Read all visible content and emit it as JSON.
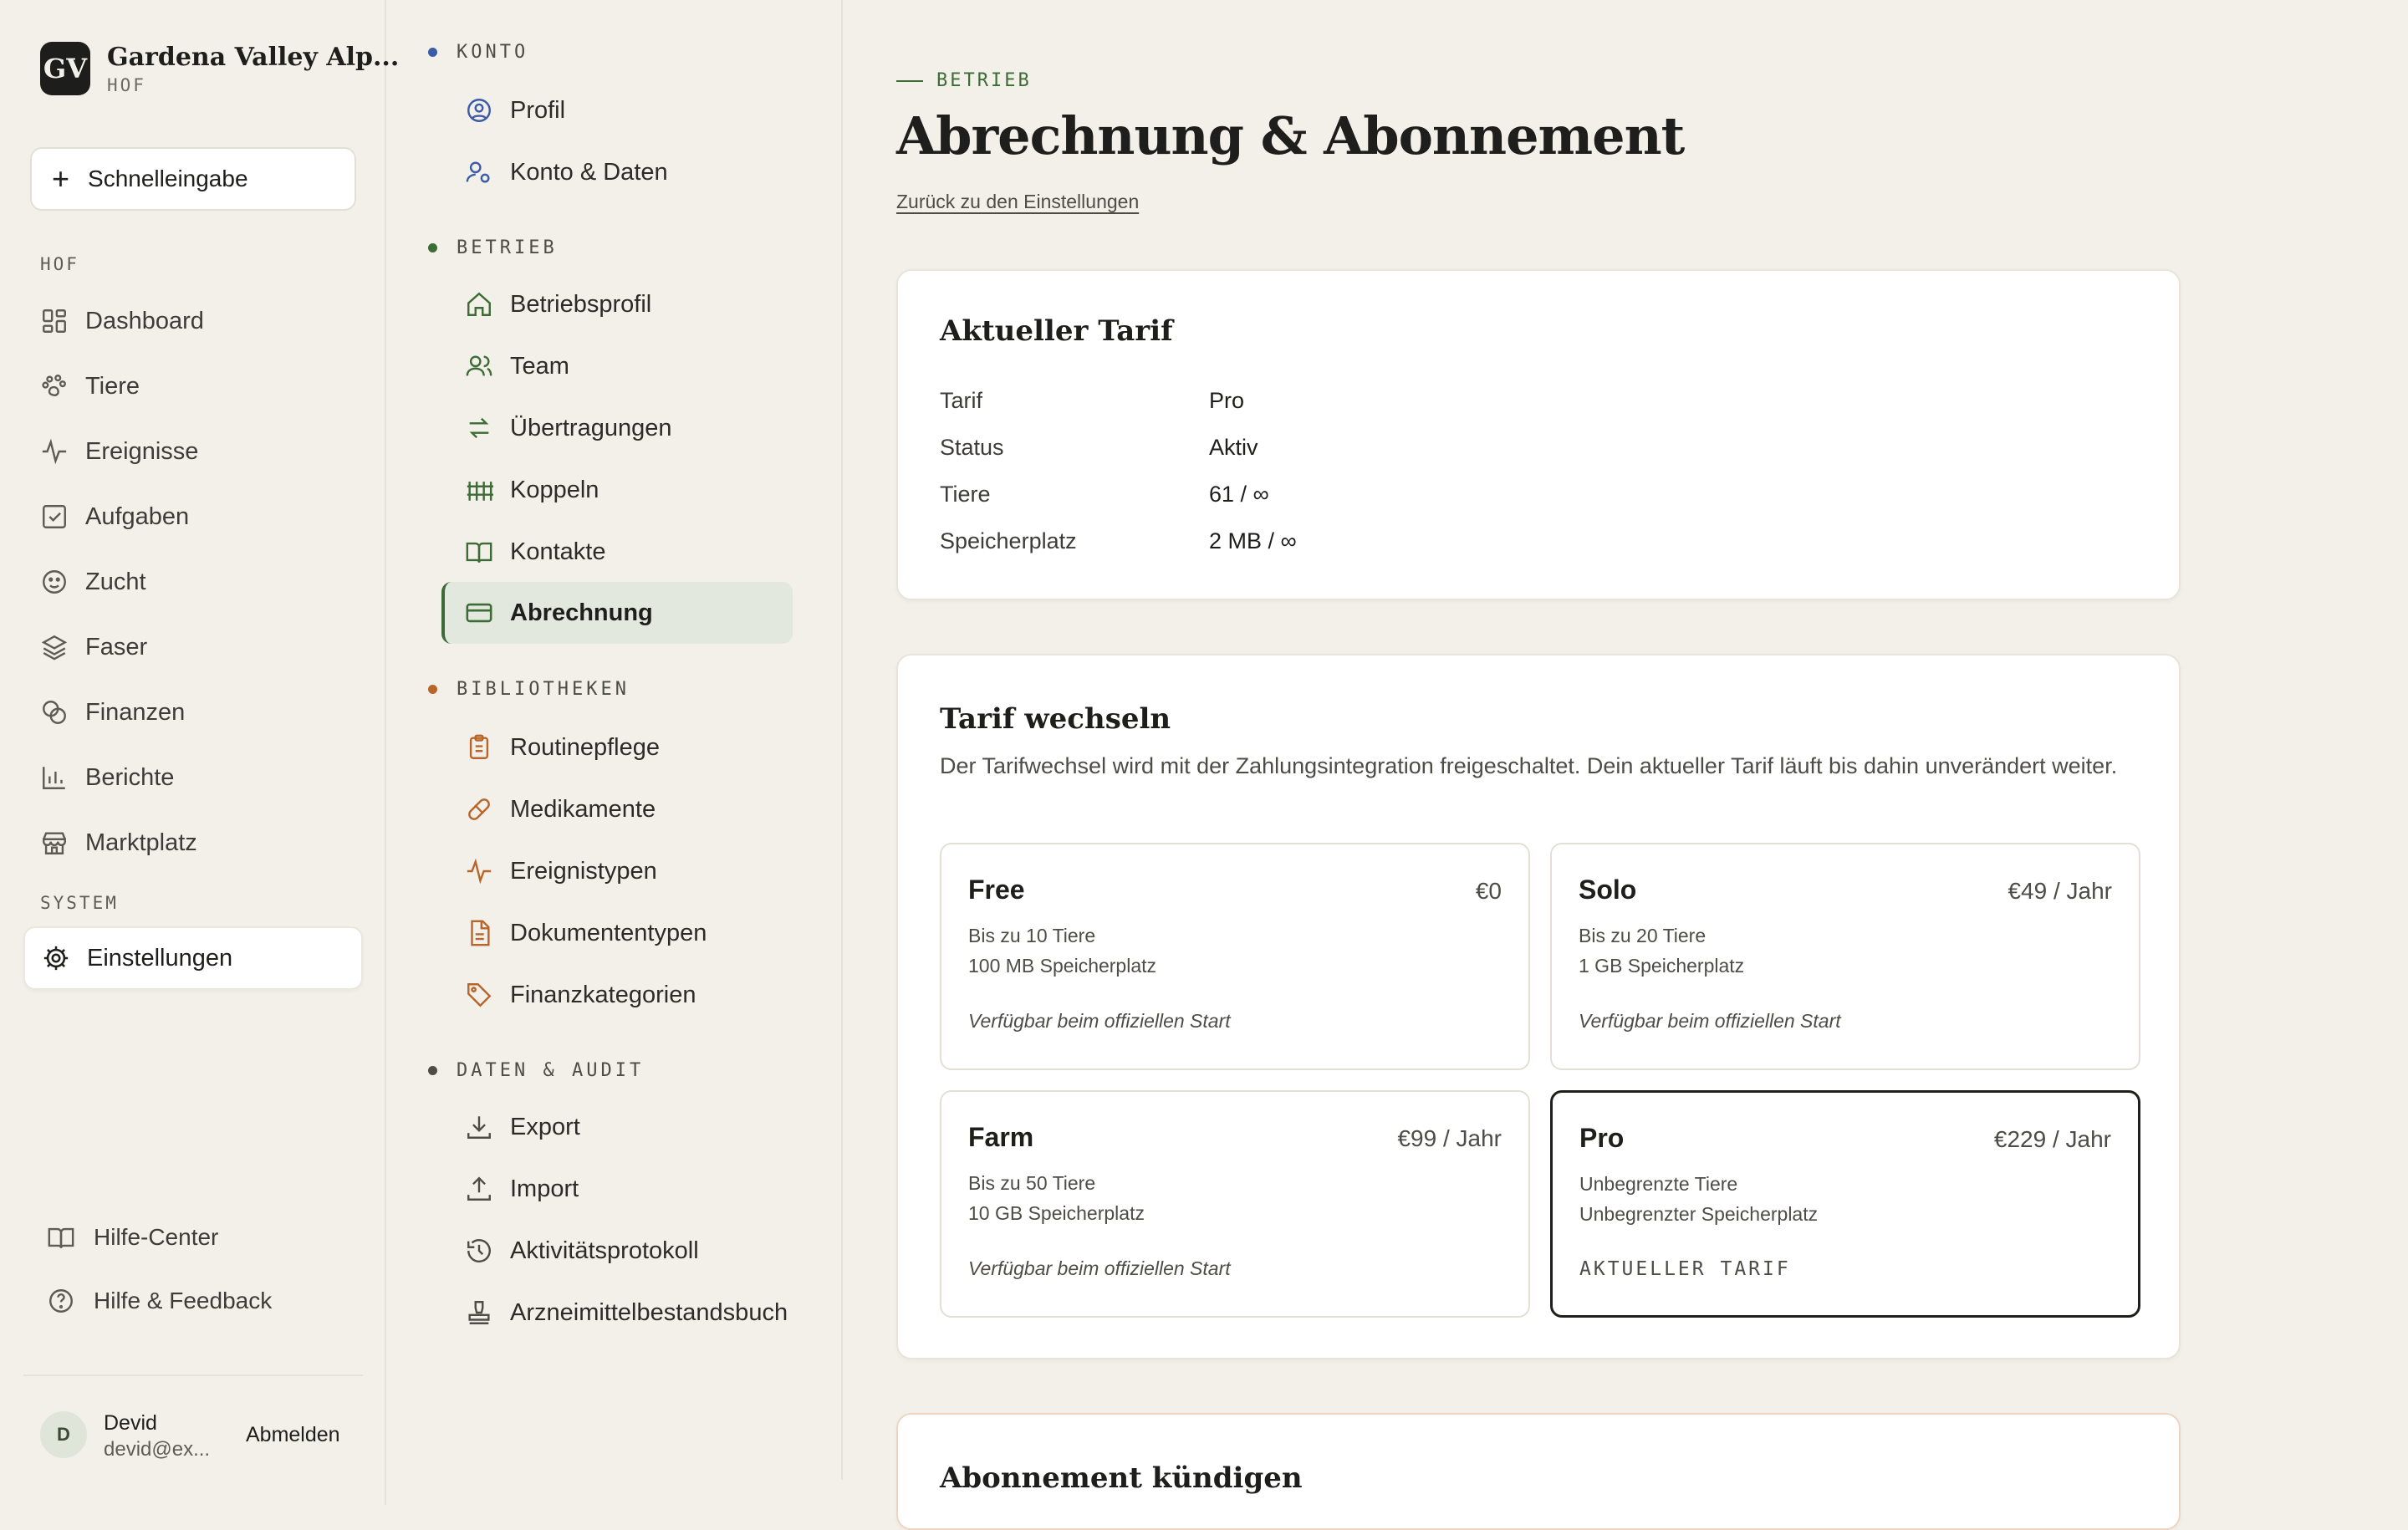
{
  "brand": {
    "logo": "GV",
    "name": "Gardena Valley Alp...",
    "subtitle": "HOF"
  },
  "quick_entry": {
    "label": "Schnelleingabe",
    "icon": "plus-icon"
  },
  "sidebar": {
    "section_hof": "HOF",
    "items": [
      {
        "label": "Dashboard",
        "icon": "dashboard-icon"
      },
      {
        "label": "Tiere",
        "icon": "paw-icon"
      },
      {
        "label": "Ereignisse",
        "icon": "pulse-icon"
      },
      {
        "label": "Aufgaben",
        "icon": "checkbox-icon"
      },
      {
        "label": "Zucht",
        "icon": "breeding-icon"
      },
      {
        "label": "Faser",
        "icon": "layers-icon"
      },
      {
        "label": "Finanzen",
        "icon": "coins-icon"
      },
      {
        "label": "Berichte",
        "icon": "bar-chart-icon"
      },
      {
        "label": "Marktplatz",
        "icon": "store-icon"
      }
    ],
    "section_system": "SYSTEM",
    "settings": {
      "label": "Einstellungen",
      "icon": "gear-icon"
    },
    "help_center": "Hilfe-Center",
    "help_feedback": "Hilfe & Feedback",
    "user": {
      "initial": "D",
      "name": "Devid",
      "email": "devid@ex...",
      "logout": "Abmelden"
    }
  },
  "settings_nav": {
    "sections": [
      {
        "title": "KONTO",
        "dot_color": "#3b5aa8",
        "items": [
          "Profil",
          "Konto & Daten"
        ]
      },
      {
        "title": "BETRIEB",
        "dot_color": "#3c6b35",
        "items": [
          "Betriebsprofil",
          "Team",
          "Übertragungen",
          "Koppeln",
          "Kontakte",
          "Abrechnung"
        ]
      },
      {
        "title": "BIBLIOTHEKEN",
        "dot_color": "#b8652a",
        "items": [
          "Routinepflege",
          "Medikamente",
          "Ereignistypen",
          "Dokumententypen",
          "Finanzkategorien"
        ]
      },
      {
        "title": "DATEN & AUDIT",
        "dot_color": "#4d4c47",
        "items": [
          "Export",
          "Import",
          "Aktivitätsprotokoll",
          "Arzneimittelbestandsbuch"
        ]
      }
    ],
    "active": "Abrechnung"
  },
  "main": {
    "eyebrow": "BETRIEB",
    "title": "Abrechnung & Abonnement",
    "back_link": "Zurück zu den Einstellungen",
    "current_plan": {
      "title": "Aktueller Tarif",
      "rows": [
        {
          "key": "Tarif",
          "value": "Pro"
        },
        {
          "key": "Status",
          "value": "Aktiv"
        },
        {
          "key": "Tiere",
          "value": "61 / ∞"
        },
        {
          "key": "Speicherplatz",
          "value": "2 MB / ∞"
        }
      ]
    },
    "change_plan": {
      "title": "Tarif wechseln",
      "description": "Der Tarifwechsel wird mit der Zahlungsintegration freigeschaltet. Dein aktueller Tarif läuft bis dahin unverändert weiter.",
      "plans": [
        {
          "name": "Free",
          "price": "€0",
          "f1": "Bis zu 10 Tiere",
          "f2": "100 MB Speicherplatz",
          "note": "Verfügbar beim offiziellen Start"
        },
        {
          "name": "Solo",
          "price": "€49 / Jahr",
          "f1": "Bis zu 20 Tiere",
          "f2": "1 GB Speicherplatz",
          "note": "Verfügbar beim offiziellen Start"
        },
        {
          "name": "Farm",
          "price": "€99 / Jahr",
          "f1": "Bis zu 50 Tiere",
          "f2": "10 GB Speicherplatz",
          "note": "Verfügbar beim offiziellen Start"
        },
        {
          "name": "Pro",
          "price": "€229 / Jahr",
          "f1": "Unbegrenzte Tiere",
          "f2": "Unbegrenzter Speicherplatz",
          "badge": "AKTUELLER TARIF"
        }
      ]
    },
    "cancel": {
      "title": "Abonnement kündigen"
    }
  },
  "colors": {
    "accent_green": "#3c6b35",
    "background": "#f2f0e9",
    "dark": "#1e1e1c",
    "orange": "#b8652a"
  }
}
